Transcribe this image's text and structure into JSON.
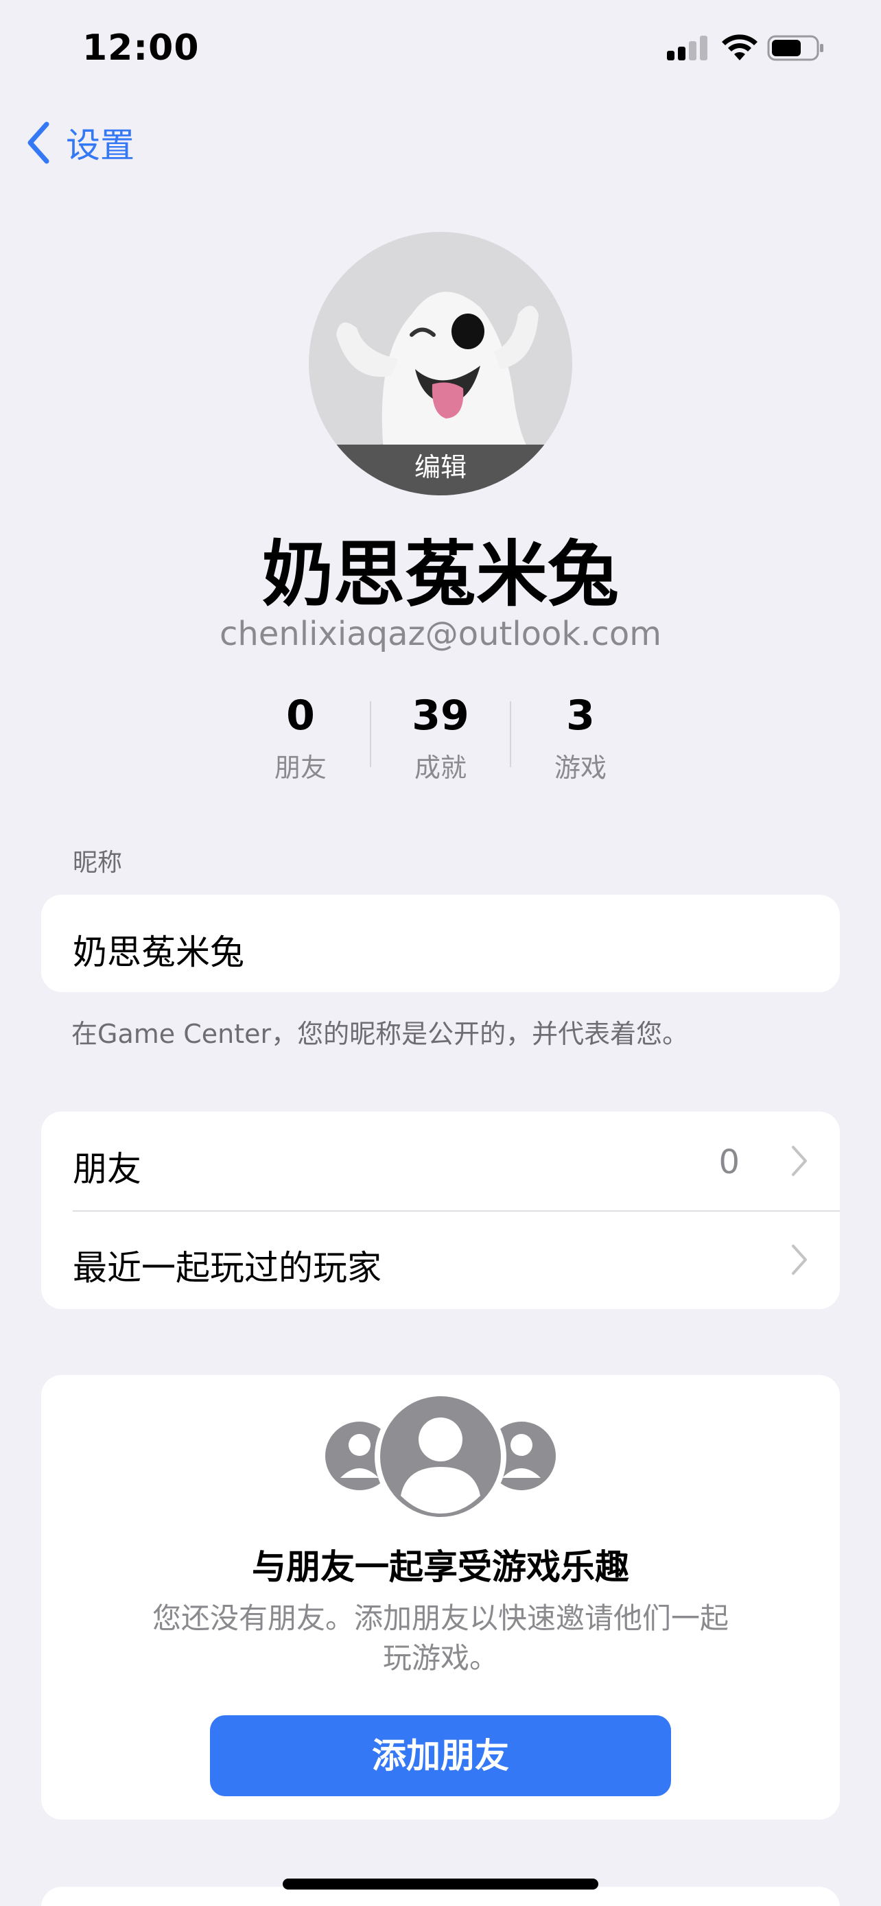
{
  "status_bar": {
    "time": "12:00"
  },
  "nav": {
    "back_label": "设置"
  },
  "profile": {
    "avatar_edit_label": "编辑",
    "display_name": "奶思菟米兔",
    "email": "chenlixiaqaz@outlook.com"
  },
  "stats": [
    {
      "value": "0",
      "label": "朋友"
    },
    {
      "value": "39",
      "label": "成就"
    },
    {
      "value": "3",
      "label": "游戏"
    }
  ],
  "nickname": {
    "section_label": "昵称",
    "value": "奶思菟米兔",
    "footnote": "在Game Center，您的昵称是公开的，并代表着您。"
  },
  "list": {
    "friends_label": "朋友",
    "friends_count": "0",
    "recent_players_label": "最近一起玩过的玩家"
  },
  "friends_promo": {
    "title": "与朋友一起享受游戏乐趣",
    "description_line1": "您还没有朋友。添加朋友以快速邀请他们一起",
    "description_line2": "玩游戏。",
    "button_label": "添加朋友"
  },
  "colors": {
    "accent": "#3478f6",
    "background": "#f1f0f6",
    "secondary_text": "#8a8a8e"
  }
}
